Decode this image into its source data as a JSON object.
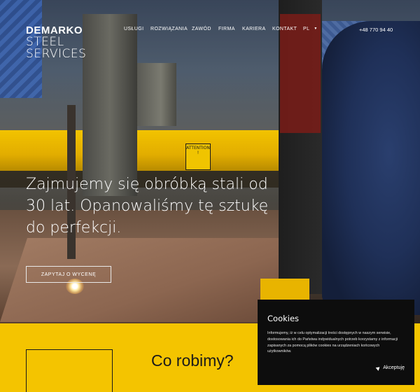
{
  "brand": {
    "name": "DEMARKO",
    "sub_line1": "STEEL",
    "sub_line2": "SERVICES"
  },
  "nav": {
    "items": [
      {
        "label": "USŁUGI"
      },
      {
        "label": "ROZWIĄZANIA"
      },
      {
        "label": "ZAWÓD"
      },
      {
        "label": "FIRMA"
      },
      {
        "label": "KARIERA"
      },
      {
        "label": "KONTAKT"
      }
    ],
    "language": "PL",
    "phone": "+48 770 94 40"
  },
  "hero": {
    "heading": "Zajmujemy się obróbką stali od 30 lat. Opanowaliśmy tę sztukę do perfekcji.",
    "cta_label": "ZAPYTAJ O WYCENĘ",
    "sign_text": "ATTENTION !"
  },
  "section": {
    "title": "Co robimy?"
  },
  "cookies": {
    "title": "Cookies",
    "text": "Informujemy, iż w celu optymalizacji treści dostępnych w naszym serwisie, dostosowania ich do Państwa indywidualnych potrzeb korzystamy z informacji zapisanych za pomocą plików cookies na urządzeniach końcowych użytkowników.",
    "accept_label": "Akceptuję"
  },
  "colors": {
    "accent_yellow": "#f4c400",
    "cookie_bg": "#0d0d0d",
    "text_dark": "#1a1a1a"
  }
}
